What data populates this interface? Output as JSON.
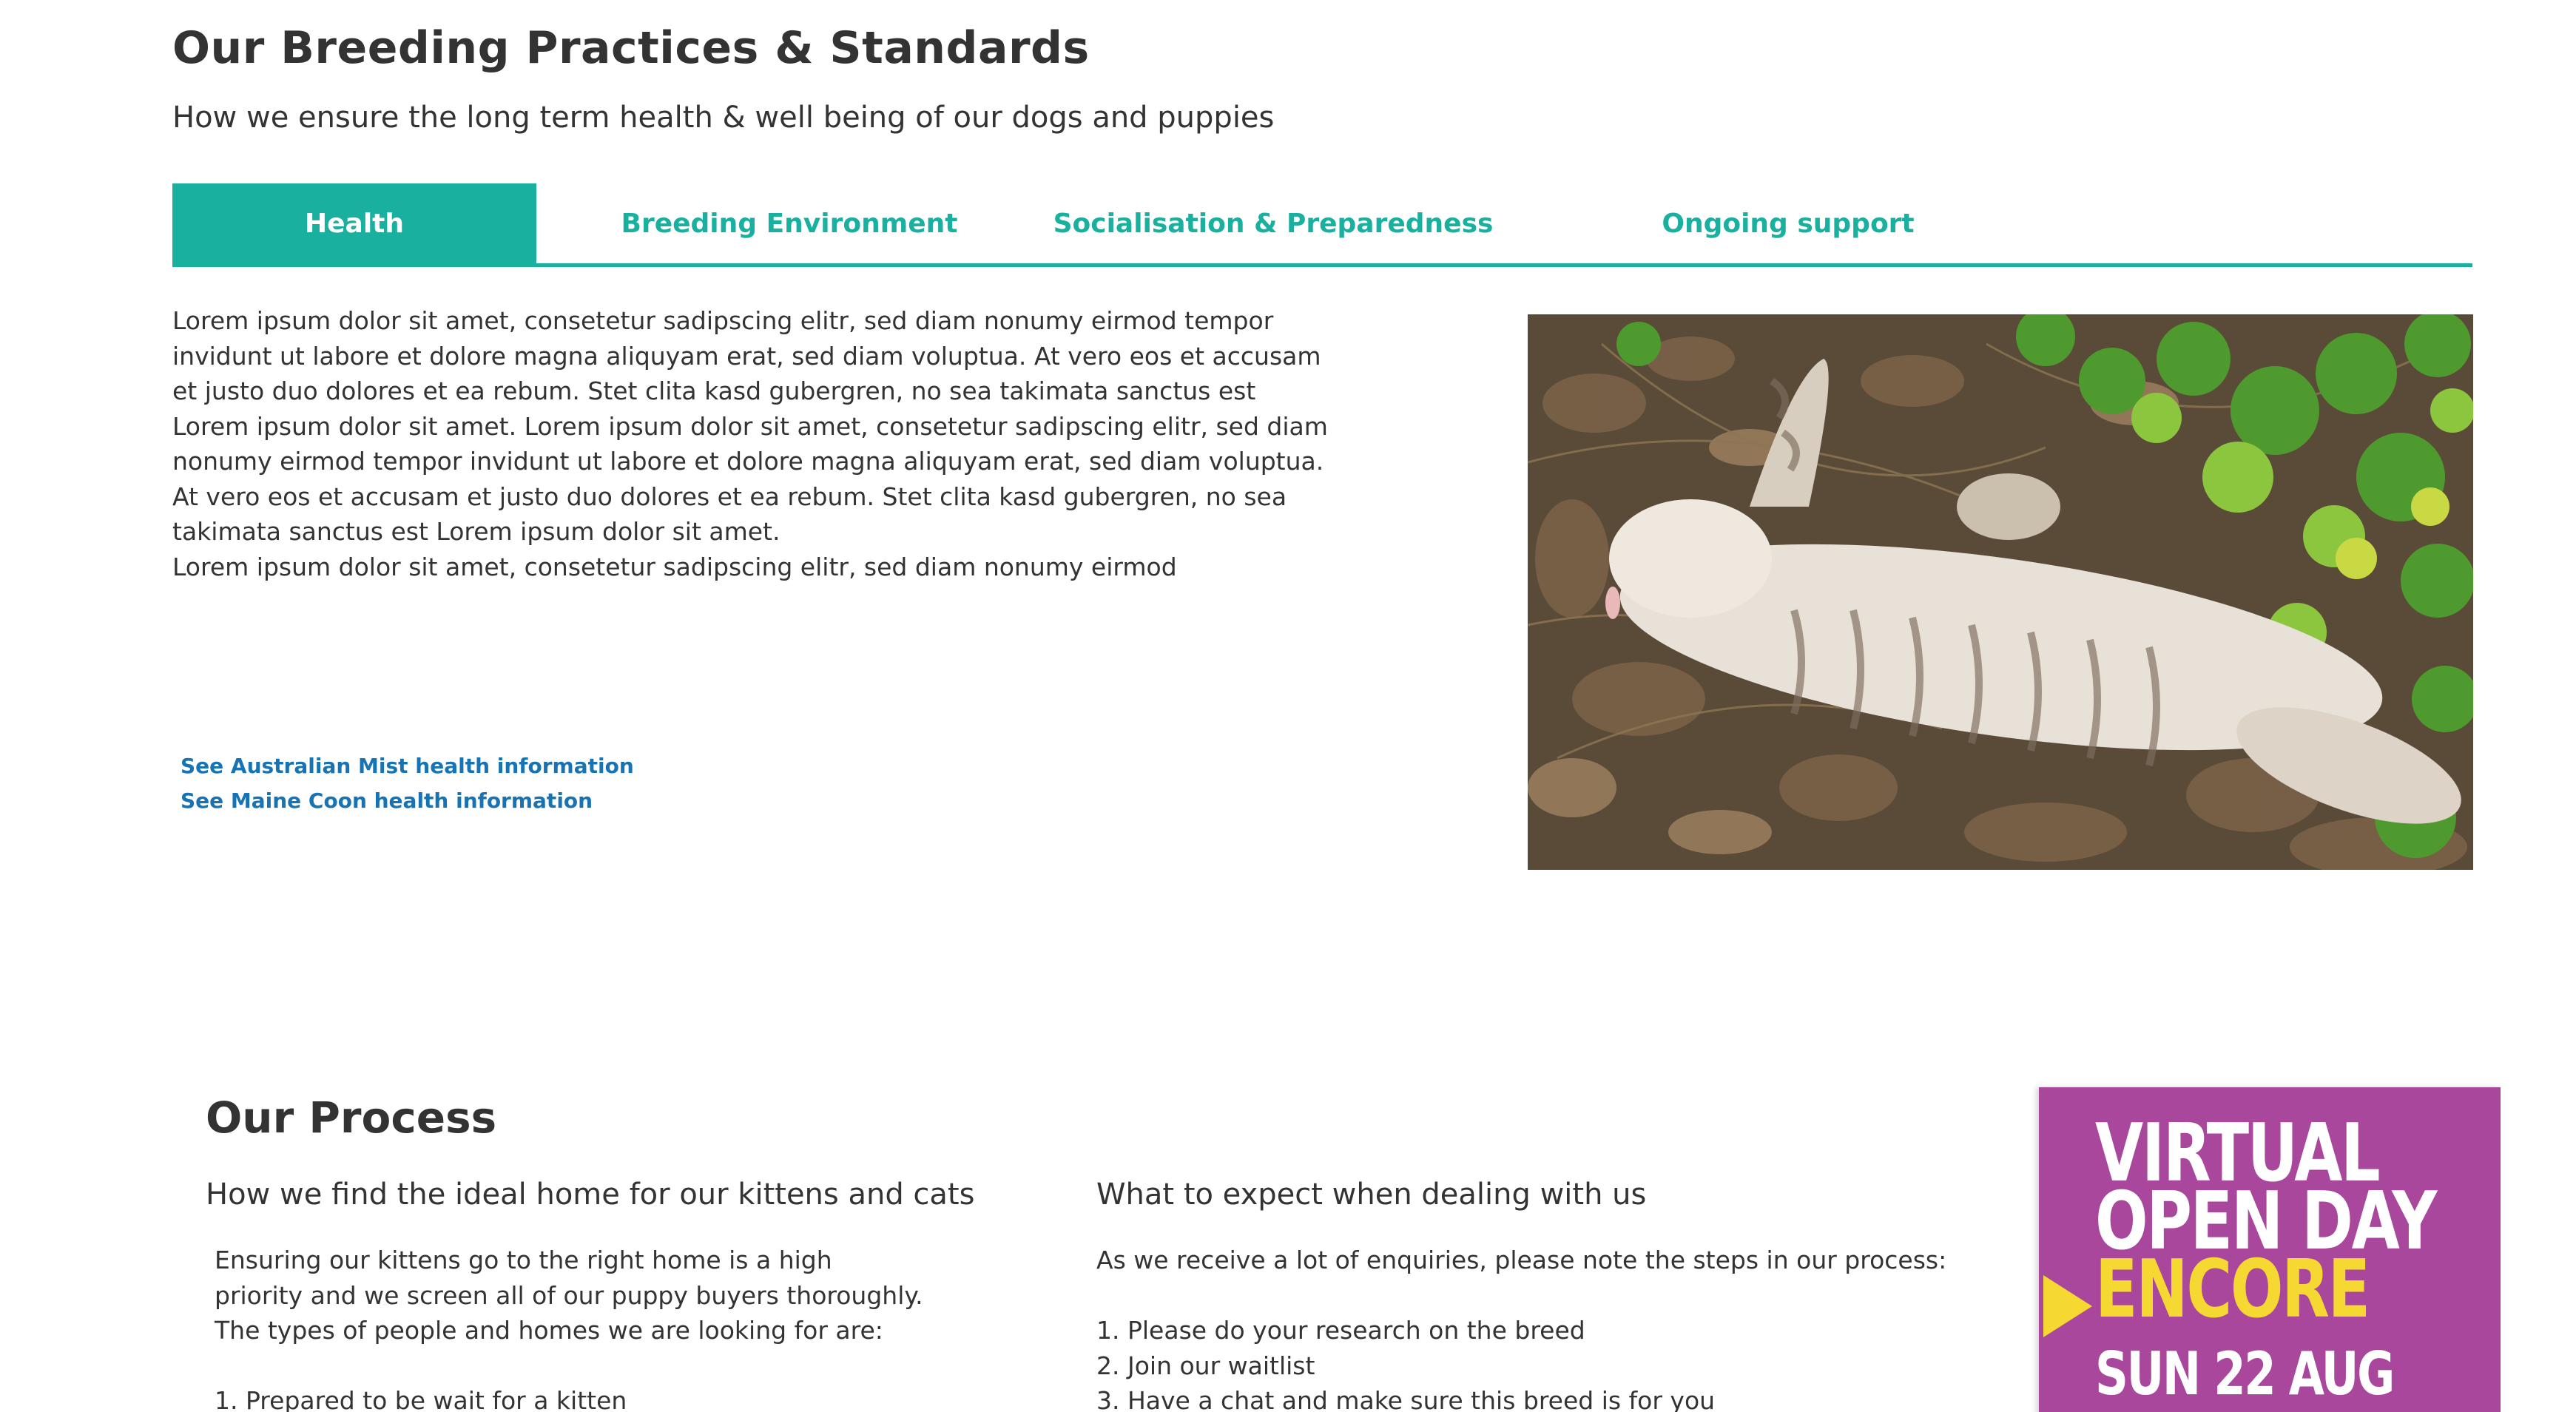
{
  "section": {
    "title": "Our Breeding Practices & Standards",
    "subtitle": "How we ensure the long term health & well being of our dogs and puppies"
  },
  "tabs": [
    {
      "label": "Health",
      "active": true
    },
    {
      "label": "Breeding Environment",
      "active": false
    },
    {
      "label": "Socialisation & Preparedness",
      "active": false
    },
    {
      "label": "Ongoing support",
      "active": false
    }
  ],
  "health": {
    "paragraph1": "Lorem ipsum dolor sit amet, consetetur sadipscing elitr, sed diam nonumy eirmod tempor invidunt ut labore et dolore magna aliquyam erat, sed diam voluptua. At vero eos et accusam et justo duo dolores et ea rebum. Stet clita kasd gubergren, no sea takimata sanctus est Lorem ipsum dolor sit amet. Lorem ipsum dolor sit amet, consetetur sadipscing elitr, sed diam nonumy eirmod tempor invidunt ut labore et dolore magna aliquyam erat, sed diam voluptua. At vero eos et accusam et justo duo dolores et ea rebum. Stet clita kasd gubergren, no sea takimata sanctus est Lorem ipsum dolor sit amet.",
    "paragraph2": "Lorem ipsum dolor sit amet, consetetur sadipscing elitr, sed diam nonumy eirmod",
    "links": [
      "See Australian Mist  health information",
      "See Maine Coon  health information"
    ]
  },
  "process": {
    "title": "Our Process",
    "col1": {
      "heading": "How we find the ideal home for our kittens and cats",
      "text": "Ensuring our kittens go to the right home is a high priority and we screen all of our puppy buyers thoroughly.  The types of people and homes we are looking for are:",
      "list": [
        "1.  Prepared to be wait for a kitten"
      ]
    },
    "col2": {
      "heading": "What to expect when dealing with us",
      "text": "As we receive a lot of enquiries, please note the steps in our process:",
      "list": [
        "1. Please do your research on the breed",
        "2. Join our waitlist",
        "3. Have a chat and make sure this breed is for you"
      ]
    }
  },
  "promo": {
    "line1": "VIRTUAL",
    "line2": "OPEN DAY",
    "line3": "ENCORE",
    "line4": "SUN 22 AUG"
  },
  "colors": {
    "accent": "#1ab0a0",
    "link": "#1773b3",
    "promo_bg": "#a8479b",
    "promo_yellow": "#f6d832"
  }
}
